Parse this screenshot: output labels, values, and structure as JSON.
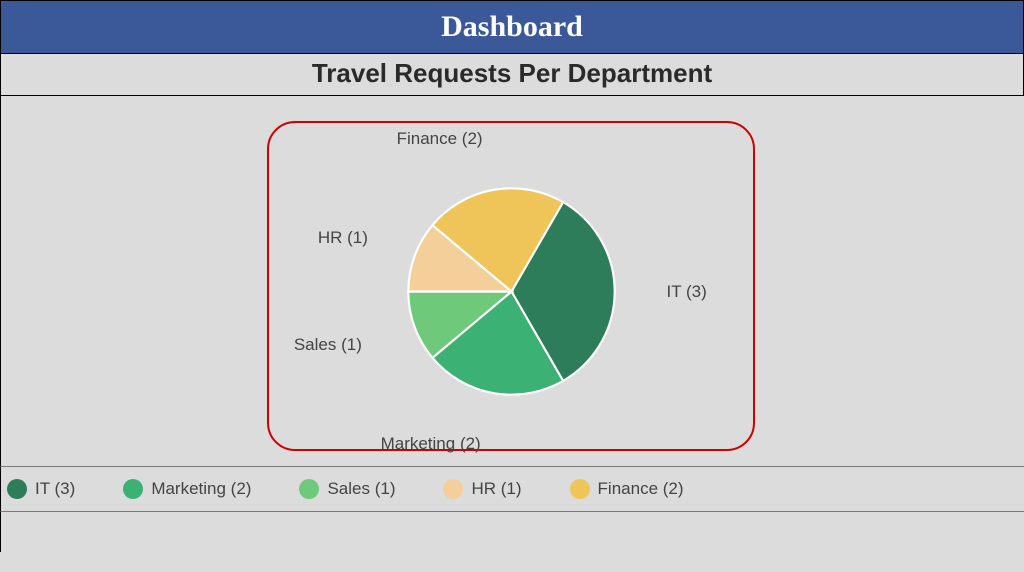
{
  "header": {
    "title": "Dashboard"
  },
  "section": {
    "title": "Travel Requests Per Department"
  },
  "chart_data": {
    "type": "pie",
    "title": "Travel Requests Per Department",
    "slices": [
      {
        "name": "IT",
        "value": 3,
        "label": "IT (3)",
        "color": "#2e7d5a"
      },
      {
        "name": "Marketing",
        "value": 2,
        "label": "Marketing (2)",
        "color": "#3bb273"
      },
      {
        "name": "Sales",
        "value": 1,
        "label": "Sales (1)",
        "color": "#6fc97a"
      },
      {
        "name": "HR",
        "value": 1,
        "label": "HR (1)",
        "color": "#f5cf9a"
      },
      {
        "name": "Finance",
        "value": 2,
        "label": "Finance (2)",
        "color": "#efc55a"
      }
    ]
  },
  "legend": {
    "items": [
      {
        "label": "IT (3)",
        "color": "#2e7d5a"
      },
      {
        "label": "Marketing (2)",
        "color": "#3bb273"
      },
      {
        "label": "Sales (1)",
        "color": "#6fc97a"
      },
      {
        "label": "HR (1)",
        "color": "#f5cf9a"
      },
      {
        "label": "Finance (2)",
        "color": "#efc55a"
      }
    ]
  }
}
